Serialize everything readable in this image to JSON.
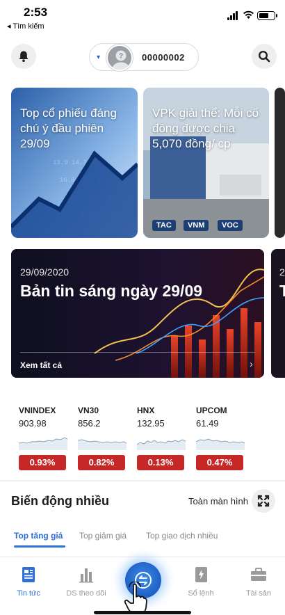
{
  "status_bar": {
    "time": "2:53",
    "back_label": "◂ Tìm kiếm"
  },
  "header": {
    "bell_icon": "bell-icon",
    "search_icon": "search-icon",
    "account": {
      "caret": "▾",
      "avatar_glyph": "?",
      "id": "00000002"
    }
  },
  "news_cards": [
    {
      "title": "Top cổ phiếu đáng chú ý đầu phiên 29/09",
      "tags": []
    },
    {
      "title": "VPK giải thể: Mỗi cổ đông được chia 5,070 đồng/ cp",
      "tags": [
        "TAC",
        "VNM",
        "VOC"
      ]
    }
  ],
  "feature": {
    "date": "29/09/2020",
    "title": "Bản tin sáng ngày 29/09",
    "link": "Xem tất cả",
    "peek_date": "2",
    "peek_title": "T"
  },
  "indices": [
    {
      "name": "VNINDEX",
      "value": "903.98",
      "change": "0.93%"
    },
    {
      "name": "VN30",
      "value": "856.2",
      "change": "0.82%"
    },
    {
      "name": "HNX",
      "value": "132.95",
      "change": "0.13%"
    },
    {
      "name": "UPCOM",
      "value": "61.49",
      "change": "0.47%"
    }
  ],
  "movers": {
    "title": "Biến động nhiều",
    "fullscreen_label": "Toàn màn hình",
    "tabs": [
      "Top tăng giá",
      "Top giảm giá",
      "Top giao dịch nhiều"
    ],
    "active_tab": 0
  },
  "nav": {
    "items": [
      {
        "label": "Tin tức",
        "icon": "news-icon",
        "active": true
      },
      {
        "label": "DS theo dõi",
        "icon": "bar-chart-icon",
        "active": false
      },
      {
        "label": "Sổ lệnh",
        "icon": "order-book-icon",
        "active": false
      },
      {
        "label": "Tài sản",
        "icon": "briefcase-icon",
        "active": false
      }
    ],
    "center_icon": "swap-icon"
  },
  "colors": {
    "accent": "#2e6fd8",
    "down_badge": "#c62828",
    "tag_bg": "#1c3f73"
  }
}
